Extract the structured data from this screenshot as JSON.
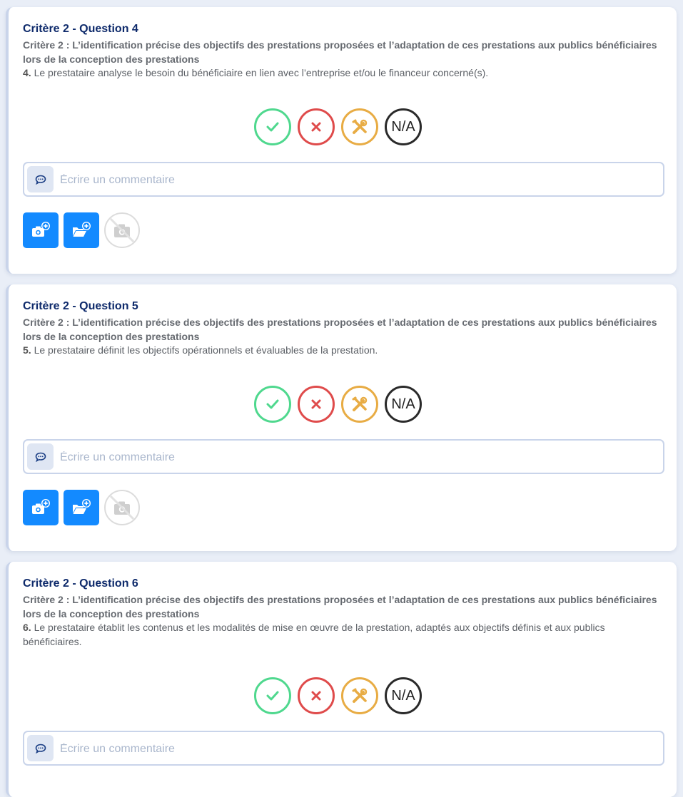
{
  "questions": [
    {
      "title": "Critère 2 - Question 4",
      "critere": "Critère 2 : L’identification précise des objectifs des prestations proposées et l’adaptation de ces prestations aux publics bénéficiaires lors de la conception des prestations",
      "number": "4.",
      "text": " Le prestataire analyse le besoin du bénéficiaire en lien avec l’entreprise et/ou le financeur concerné(s).",
      "na_label": "N/A",
      "comment_placeholder": "Écrire un commentaire"
    },
    {
      "title": "Critère 2 - Question 5",
      "critere": "Critère 2 : L’identification précise des objectifs des prestations proposées et l’adaptation de ces prestations aux publics bénéficiaires lors de la conception des prestations",
      "number": "5.",
      "text": " Le prestataire définit les objectifs opérationnels et évaluables de la prestation.",
      "na_label": "N/A",
      "comment_placeholder": "Écrire un commentaire"
    },
    {
      "title": "Critère 2 - Question 6",
      "critere": "Critère 2 : L’identification précise des objectifs des prestations proposées et l’adaptation de ces prestations aux publics bénéficiaires lors de la conception des prestations",
      "number": "6.",
      "text": " Le prestataire établit les contenus et les modalités de mise en œuvre de la prestation, adaptés aux objectifs définis et aux publics bénéficiaires.",
      "na_label": "N/A",
      "comment_placeholder": "Écrire un commentaire"
    }
  ],
  "icons": {
    "conforme": "check-icon",
    "non_conforme": "cross-icon",
    "amelioration": "tools-icon",
    "comment": "comment-icon",
    "add_photo": "camera-add-icon",
    "add_file": "folder-add-icon",
    "no_photo": "no-photo-icon"
  },
  "colors": {
    "title": "#0e2a6b",
    "ok": "#4fd88e",
    "ko": "#df4b4b",
    "fix": "#e8ac44",
    "na": "#2a2a2a",
    "media_button": "#138aff",
    "background": "#e9eef7"
  }
}
